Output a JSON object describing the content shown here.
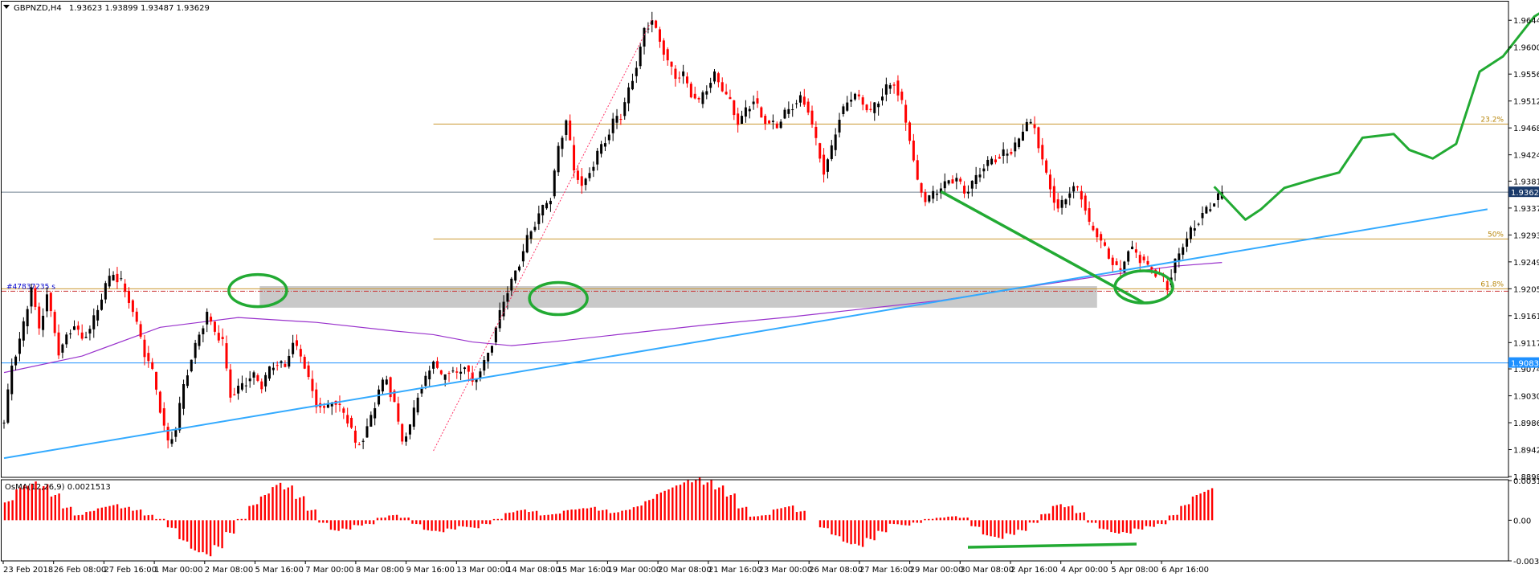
{
  "header": {
    "symbol": "GBPNZD,H4",
    "ohlc": "1.93623 1.93899 1.93487 1.93629"
  },
  "chart_data": {
    "type": "candlestick",
    "symbol": "GBPNZD",
    "timeframe": "H4",
    "price_ticks": [
      "1.96440",
      "1.96000",
      "1.95560",
      "1.95120",
      "1.94680",
      "1.94240",
      "1.93810",
      "1.93370",
      "1.92930",
      "1.92490",
      "1.92050",
      "1.91610",
      "1.91170",
      "1.90740",
      "1.90300",
      "1.89860",
      "1.89420",
      "1.88980"
    ],
    "price_range": [
      1.8898,
      1.9664
    ],
    "current_price": "1.93629",
    "current_price_value": 1.93629,
    "horizontal_line": {
      "label": "1.90838",
      "value": 1.90838
    },
    "time_labels": [
      "23 Feb 2018",
      "26 Feb 08:00",
      "27 Feb 16:00",
      "1 Mar 00:00",
      "2 Mar 08:00",
      "5 Mar 16:00",
      "7 Mar 00:00",
      "8 Mar 08:00",
      "9 Mar 16:00",
      "13 Mar 00:00",
      "14 Mar 08:00",
      "15 Mar 16:00",
      "19 Mar 00:00",
      "20 Mar 08:00",
      "21 Mar 16:00",
      "23 Mar 00:00",
      "26 Mar 08:00",
      "27 Mar 16:00",
      "29 Mar 00:00",
      "30 Mar 08:00",
      "2 Apr 16:00",
      "4 Apr 00:00",
      "5 Apr 08:00",
      "6 Apr 16:00"
    ],
    "fibonacci": [
      {
        "label": "23.2%",
        "value": 1.94743
      },
      {
        "label": "50%",
        "value": 1.92865
      },
      {
        "label": "61.8%",
        "value": 1.9205
      }
    ],
    "order_label": "#47837235 s",
    "support_zone": [
      1.91741,
      1.92093
    ],
    "close_path": [
      [
        0,
        1.8985
      ],
      [
        2,
        1.9078
      ],
      [
        5,
        1.9145
      ],
      [
        7,
        1.9208
      ],
      [
        9,
        1.9138
      ],
      [
        11,
        1.9198
      ],
      [
        14,
        1.9102
      ],
      [
        16,
        1.9129
      ],
      [
        18,
        1.9145
      ],
      [
        20,
        1.9122
      ],
      [
        22,
        1.914
      ],
      [
        24,
        1.917
      ],
      [
        26,
        1.921
      ],
      [
        28,
        1.9228
      ],
      [
        30,
        1.9215
      ],
      [
        32,
        1.9185
      ],
      [
        34,
        1.9148
      ],
      [
        36,
        1.91
      ],
      [
        38,
        1.907
      ],
      [
        40,
        1.9008
      ],
      [
        42,
        1.8954
      ],
      [
        44,
        1.8975
      ],
      [
        46,
        1.9045
      ],
      [
        48,
        1.9092
      ],
      [
        50,
        1.913
      ],
      [
        52,
        1.9162
      ],
      [
        54,
        1.9135
      ],
      [
        56,
        1.9115
      ],
      [
        58,
        1.903
      ],
      [
        60,
        1.904
      ],
      [
        62,
        1.9055
      ],
      [
        64,
        1.9062
      ],
      [
        66,
        1.9048
      ],
      [
        68,
        1.9072
      ],
      [
        70,
        1.9085
      ],
      [
        72,
        1.9076
      ],
      [
        74,
        1.9118
      ],
      [
        76,
        1.9095
      ],
      [
        78,
        1.906
      ],
      [
        80,
        1.9015
      ],
      [
        82,
        1.9008
      ],
      [
        84,
        1.9022
      ],
      [
        86,
        1.901
      ],
      [
        88,
        1.8993
      ],
      [
        90,
        1.8952
      ],
      [
        92,
        1.8962
      ],
      [
        94,
        1.8995
      ],
      [
        96,
        1.904
      ],
      [
        98,
        1.9058
      ],
      [
        100,
        1.9015
      ],
      [
        102,
        1.8955
      ],
      [
        104,
        1.8978
      ],
      [
        106,
        1.9032
      ],
      [
        108,
        1.9055
      ],
      [
        110,
        1.9088
      ],
      [
        112,
        1.9058
      ],
      [
        114,
        1.9072
      ],
      [
        116,
        1.9065
      ],
      [
        118,
        1.908
      ],
      [
        120,
        1.9052
      ],
      [
        122,
        1.9072
      ],
      [
        124,
        1.91
      ],
      [
        126,
        1.914
      ],
      [
        128,
        1.9185
      ],
      [
        130,
        1.9218
      ],
      [
        132,
        1.9248
      ],
      [
        134,
        1.9285
      ],
      [
        136,
        1.9312
      ],
      [
        138,
        1.9335
      ],
      [
        140,
        1.9355
      ],
      [
        142,
        1.9435
      ],
      [
        144,
        1.948
      ],
      [
        146,
        1.94
      ],
      [
        148,
        1.9372
      ],
      [
        150,
        1.9395
      ],
      [
        152,
        1.9425
      ],
      [
        154,
        1.9445
      ],
      [
        156,
        1.9478
      ],
      [
        158,
        1.949
      ],
      [
        160,
        1.953
      ],
      [
        162,
        1.957
      ],
      [
        164,
        1.9628
      ],
      [
        166,
        1.9645
      ],
      [
        168,
        1.961
      ],
      [
        170,
        1.9578
      ],
      [
        172,
        1.9548
      ],
      [
        174,
        1.9555
      ],
      [
        176,
        1.9525
      ],
      [
        178,
        1.951
      ],
      [
        180,
        1.9535
      ],
      [
        182,
        1.9555
      ],
      [
        184,
        1.953
      ],
      [
        186,
        1.9512
      ],
      [
        188,
        1.9475
      ],
      [
        190,
        1.9498
      ],
      [
        192,
        1.9515
      ],
      [
        194,
        1.9488
      ],
      [
        196,
        1.9478
      ],
      [
        198,
        1.947
      ],
      [
        200,
        1.9492
      ],
      [
        202,
        1.9505
      ],
      [
        204,
        1.9518
      ],
      [
        206,
        1.9498
      ],
      [
        208,
        1.9445
      ],
      [
        210,
        1.9398
      ],
      [
        212,
        1.9432
      ],
      [
        214,
        1.9488
      ],
      [
        216,
        1.951
      ],
      [
        218,
        1.9525
      ],
      [
        220,
        1.9508
      ],
      [
        222,
        1.9495
      ],
      [
        224,
        1.951
      ],
      [
        226,
        1.9532
      ],
      [
        228,
        1.9545
      ],
      [
        230,
        1.9505
      ],
      [
        232,
        1.945
      ],
      [
        234,
        1.9375
      ],
      [
        236,
        1.935
      ],
      [
        238,
        1.9358
      ],
      [
        240,
        1.937
      ],
      [
        242,
        1.9382
      ],
      [
        244,
        1.9385
      ],
      [
        246,
        1.936
      ],
      [
        248,
        1.9378
      ],
      [
        250,
        1.9398
      ],
      [
        252,
        1.941
      ],
      [
        254,
        1.9418
      ],
      [
        256,
        1.9425
      ],
      [
        258,
        1.943
      ],
      [
        260,
        1.9448
      ],
      [
        262,
        1.9478
      ],
      [
        264,
        1.9468
      ],
      [
        266,
        1.9415
      ],
      [
        268,
        1.937
      ],
      [
        270,
        1.9335
      ],
      [
        272,
        1.9355
      ],
      [
        274,
        1.9372
      ],
      [
        276,
        1.9358
      ],
      [
        278,
        1.931
      ],
      [
        280,
        1.9292
      ],
      [
        282,
        1.9268
      ],
      [
        284,
        1.9248
      ],
      [
        286,
        1.9232
      ],
      [
        288,
        1.9272
      ],
      [
        290,
        1.9262
      ],
      [
        292,
        1.925
      ],
      [
        294,
        1.9235
      ],
      [
        296,
        1.9225
      ],
      [
        298,
        1.921
      ],
      [
        300,
        1.925
      ],
      [
        302,
        1.9275
      ],
      [
        304,
        1.9298
      ],
      [
        306,
        1.9318
      ],
      [
        308,
        1.9335
      ],
      [
        310,
        1.9348
      ],
      [
        312,
        1.9362
      ]
    ],
    "ma_path": [
      [
        0,
        1.9068
      ],
      [
        20,
        1.9095
      ],
      [
        40,
        1.9142
      ],
      [
        60,
        1.9158
      ],
      [
        80,
        1.915
      ],
      [
        100,
        1.9136
      ],
      [
        110,
        1.913
      ],
      [
        120,
        1.9118
      ],
      [
        130,
        1.9112
      ],
      [
        140,
        1.9118
      ],
      [
        160,
        1.9132
      ],
      [
        180,
        1.9146
      ],
      [
        200,
        1.9158
      ],
      [
        220,
        1.9172
      ],
      [
        240,
        1.9186
      ],
      [
        260,
        1.9206
      ],
      [
        280,
        1.9225
      ],
      [
        300,
        1.9242
      ],
      [
        312,
        1.9248
      ]
    ],
    "trendline": {
      "from": [
        0,
        1.8928
      ],
      "to": [
        380,
        1.9335
      ]
    },
    "downtrend": {
      "from": [
        240,
        1.9364
      ],
      "to": [
        292,
        1.9182
      ]
    },
    "retracement": {
      "from": [
        110,
        1.894
      ],
      "to": [
        166,
        1.9645
      ]
    },
    "forecast_path": [
      [
        310,
        1.9372
      ],
      [
        318,
        1.9318
      ],
      [
        322,
        1.9335
      ],
      [
        328,
        1.937
      ],
      [
        336,
        1.9385
      ],
      [
        342,
        1.9395
      ],
      [
        348,
        1.9452
      ],
      [
        356,
        1.9458
      ],
      [
        360,
        1.9432
      ],
      [
        366,
        1.9418
      ],
      [
        372,
        1.9442
      ],
      [
        378,
        1.956
      ],
      [
        384,
        1.9585
      ],
      [
        392,
        1.965
      ],
      [
        400,
        1.9682
      ]
    ],
    "support_ellipses": [
      [
        65,
        1.9202
      ],
      [
        142,
        1.9189
      ],
      [
        292,
        1.9208
      ]
    ],
    "osma": {
      "label": "OsMA(12,26,9) 0.0021513",
      "ticks": [
        "0.003149",
        "0.00",
        "-0.003231"
      ],
      "range": [
        -0.003231,
        0.003149
      ],
      "values": [
        0.0015,
        0.0026,
        0.0029,
        0.0027,
        0.002,
        0.001,
        0.0004,
        0.0007,
        0.001,
        0.0012,
        0.001,
        0.0008,
        0.0004,
        0.0001,
        -0.0006,
        -0.0016,
        -0.0024,
        -0.0027,
        -0.0021,
        -0.001,
        0.0001,
        0.0012,
        0.002,
        0.0028,
        0.0026,
        0.0018,
        0.0008,
        -0.0002,
        -0.0008,
        -0.0007,
        -0.0004,
        -0.0003,
        0.0002,
        0.0004,
        0.0002,
        -0.0003,
        -0.0008,
        -0.0009,
        -0.0007,
        -0.0005,
        -0.0006,
        -0.0003,
        0.0001,
        0.0006,
        0.0008,
        0.0007,
        0.0004,
        0.0005,
        0.0008,
        0.0009,
        0.001,
        0.0008,
        0.0006,
        0.0008,
        0.0011,
        0.0016,
        0.0022,
        0.0026,
        0.003,
        0.0032,
        0.003,
        0.0026,
        0.002,
        0.001,
        0.0003,
        0.0004,
        0.0009,
        0.0011,
        0.0007,
        0.0,
        -0.0006,
        -0.0012,
        -0.0018,
        -0.002,
        -0.0015,
        -0.0009,
        -0.0003,
        -0.0004,
        -0.0002,
        0.0001,
        0.0002,
        0.0003,
        0.0002,
        -0.0005,
        -0.0012,
        -0.0014,
        -0.0011,
        -0.0008,
        -0.0002,
        0.0005,
        0.0012,
        0.0011,
        0.0006,
        -0.0002,
        -0.0007,
        -0.001,
        -0.001,
        -0.0007,
        -0.0005,
        -0.0003,
        0.0004,
        0.0012,
        0.002,
        0.0024
      ]
    }
  }
}
